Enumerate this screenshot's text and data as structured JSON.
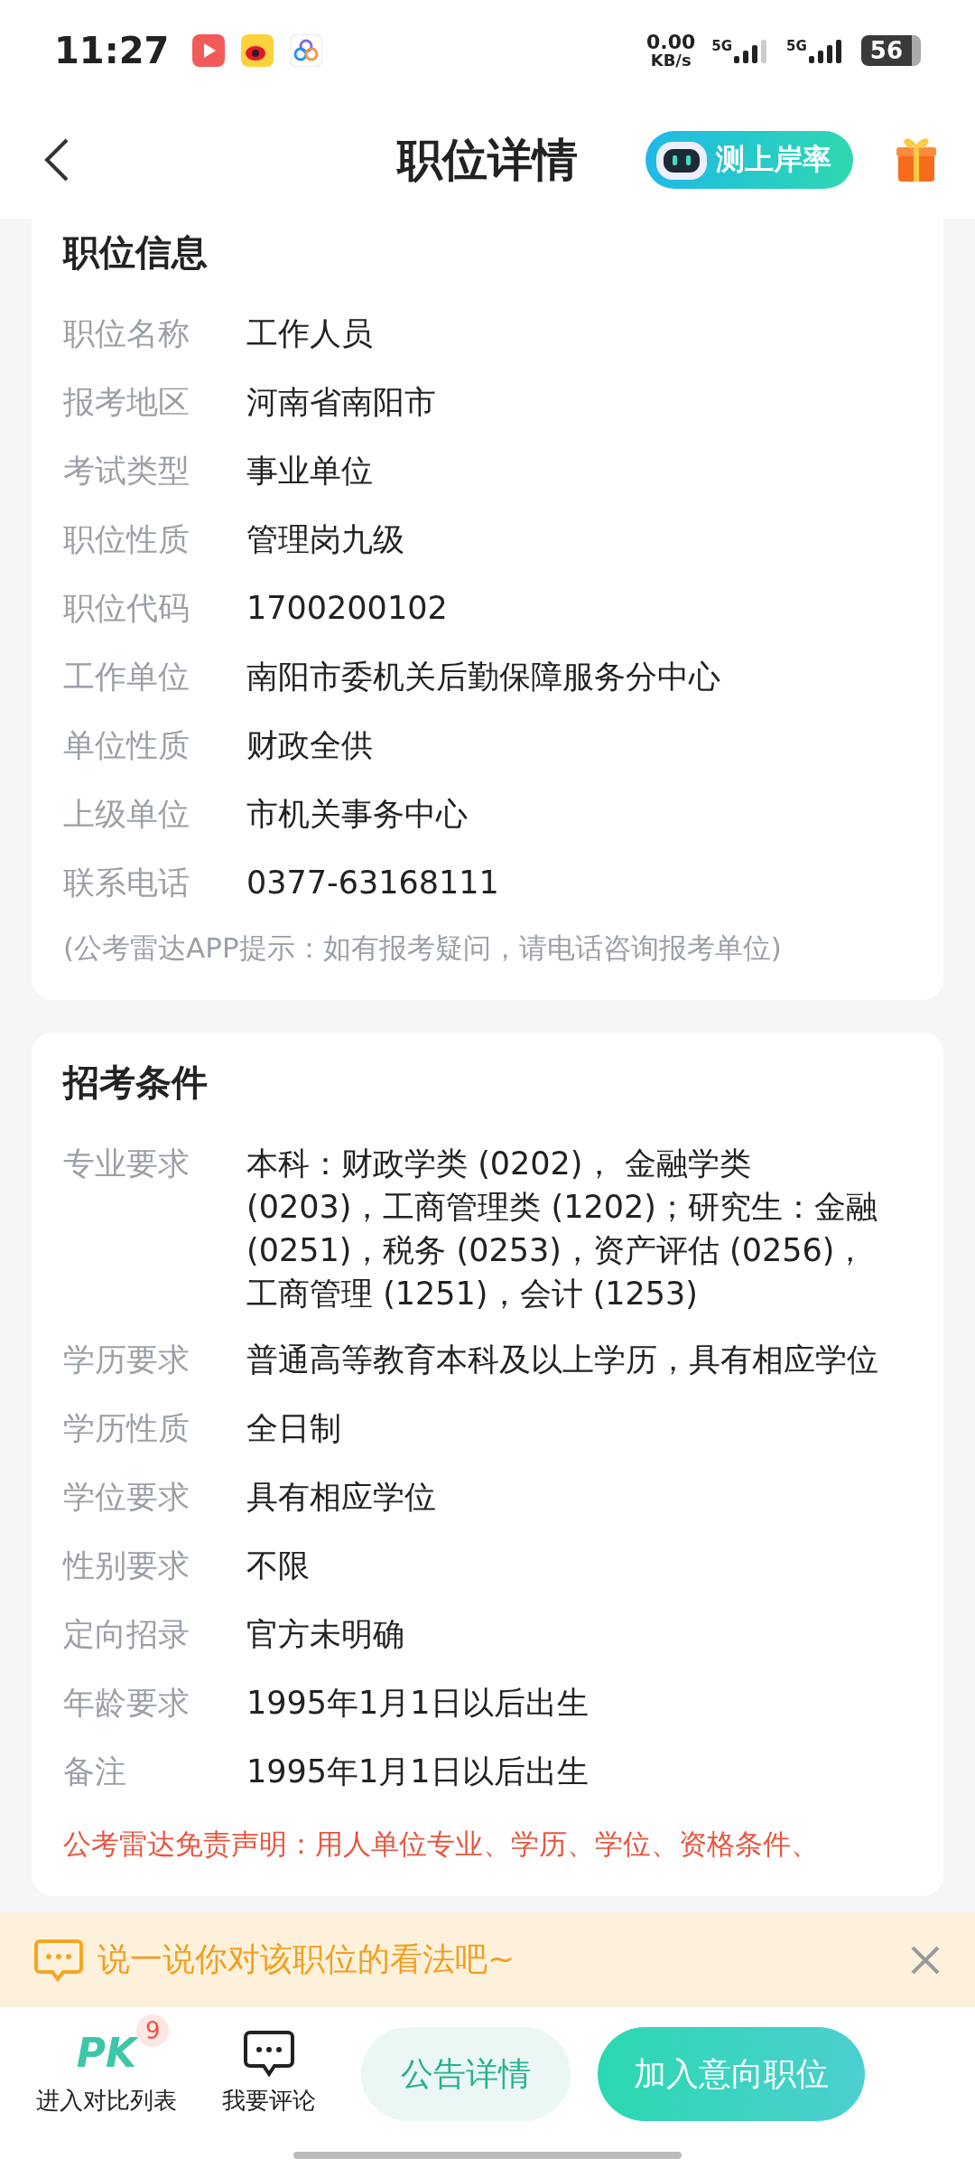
{
  "status_bar": {
    "time": "11:27",
    "net_speed": "0.00",
    "net_unit": "KB/s",
    "signals": [
      "5G",
      "5G"
    ],
    "battery": "56"
  },
  "header": {
    "title": "职位详情",
    "rate_button": "测上岸率"
  },
  "position_info": {
    "title": "职位信息",
    "rows": [
      {
        "label": "职位名称",
        "value": "工作人员"
      },
      {
        "label": "报考地区",
        "value": "河南省南阳市"
      },
      {
        "label": "考试类型",
        "value": "事业单位"
      },
      {
        "label": "职位性质",
        "value": "管理岗九级"
      },
      {
        "label": "职位代码",
        "value": "1700200102"
      },
      {
        "label": "工作单位",
        "value": "南阳市委机关后勤保障服务分中心"
      },
      {
        "label": "单位性质",
        "value": "财政全供"
      },
      {
        "label": "上级单位",
        "value": "市机关事务中心"
      },
      {
        "label": "联系电话",
        "value": "0377-63168111"
      }
    ],
    "note": "(公考雷达APP提示：如有报考疑问，请电话咨询报考单位)"
  },
  "requirements": {
    "title": "招考条件",
    "rows": [
      {
        "label": "专业要求",
        "value": "本科：财政学类 (0202)， 金融学类 (0203)，工商管理类 (1202)；研究生：金融 (0251)，税务 (0253)，资产评估 (0256)，工商管理 (1251)，会计 (1253)"
      },
      {
        "label": "学历要求",
        "value": "普通高等教育本科及以上学历，具有相应学位"
      },
      {
        "label": "学历性质",
        "value": "全日制"
      },
      {
        "label": "学位要求",
        "value": "具有相应学位"
      },
      {
        "label": "性别要求",
        "value": "不限"
      },
      {
        "label": "定向招录",
        "value": "官方未明确"
      },
      {
        "label": "年龄要求",
        "value": "1995年1月1日以后出生"
      },
      {
        "label": "备注",
        "value": "1995年1月1日以后出生"
      }
    ],
    "disclaimer": "公考雷达免责声明：用人单位专业、学历、学位、资格条件、"
  },
  "comment_banner": {
    "text": "说一说你对该职位的看法吧~"
  },
  "bottom_bar": {
    "compare": {
      "logo": "PK",
      "badge": "9",
      "label": "进入对比列表"
    },
    "comment": {
      "label": "我要评论"
    },
    "notice_button": "公告详情",
    "join_button": "加入意向职位"
  }
}
